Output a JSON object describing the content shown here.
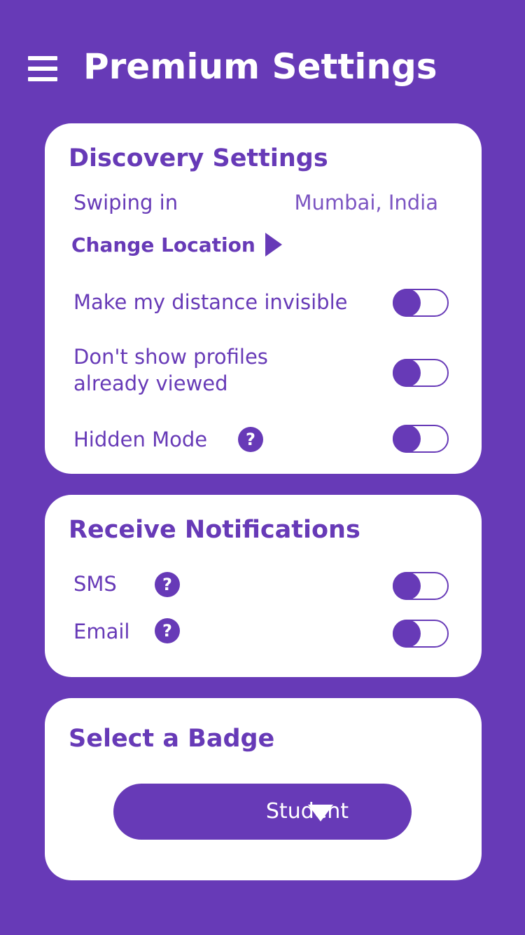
{
  "header": {
    "menu_icon": "hamburger-menu-icon",
    "title": "Premium Settings"
  },
  "discovery": {
    "title": "Discovery Settings",
    "swiping_label": "Swiping in",
    "swiping_value": "Mumbai, India",
    "change_location_label": "Change Location",
    "change_location_icon": "play-arrow-icon",
    "items": [
      {
        "label": "Make my distance invisible",
        "enabled": false
      },
      {
        "label_line1": "Don't show profiles",
        "label_line2": "already viewed",
        "enabled": false
      },
      {
        "label": "Hidden Mode",
        "help_icon": "question-circle-icon",
        "enabled": false
      }
    ]
  },
  "notifications": {
    "title": "Receive Notifications",
    "items": [
      {
        "label": "SMS",
        "help_icon": "question-circle-icon",
        "enabled": false
      },
      {
        "label": "Email",
        "help_icon": "question-circle-icon",
        "enabled": false
      }
    ]
  },
  "badge": {
    "title": "Select a Badge",
    "selected": "Student",
    "dropdown_icon": "caret-down-icon"
  },
  "colors": {
    "accent": "#673ab7",
    "card": "#ffffff"
  }
}
